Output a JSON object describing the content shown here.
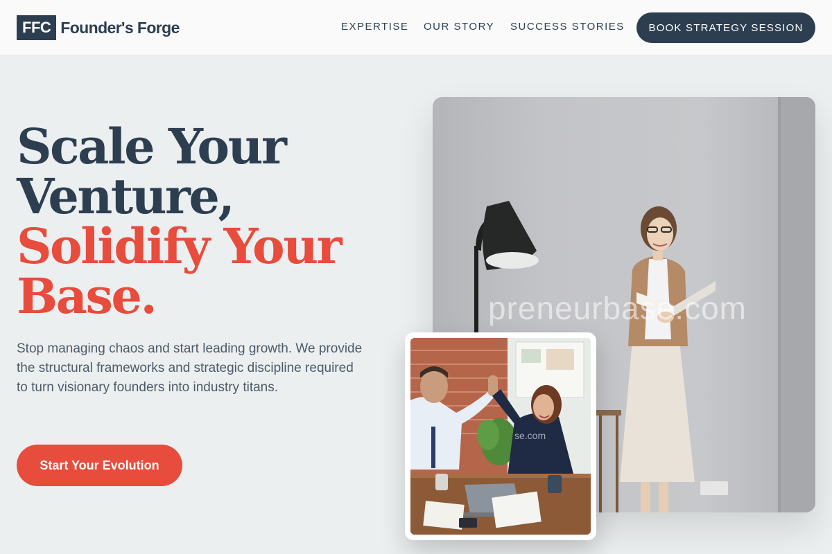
{
  "brand": {
    "mark": "FFC",
    "name": "Founder's Forge",
    "primary_color": "#2c3e50",
    "accent_color": "#e74c3c"
  },
  "nav": {
    "links": [
      "EXPERTISE",
      "OUR STORY",
      "SUCCESS STORIES"
    ],
    "cta_label": "BOOK STRATEGY SESSION"
  },
  "hero": {
    "headline_lines": [
      "Scale Your",
      "Venture,",
      "Solidify Your",
      "Base."
    ],
    "description": "Stop managing chaos and start leading growth. We provide the structural frameworks and strategic discipline required to turn visionary founders into industry titans.",
    "cta_label": "Start Your Evolution"
  },
  "images": {
    "main_watermark": "preneurbase.com",
    "inset_watermark": "se.com"
  }
}
